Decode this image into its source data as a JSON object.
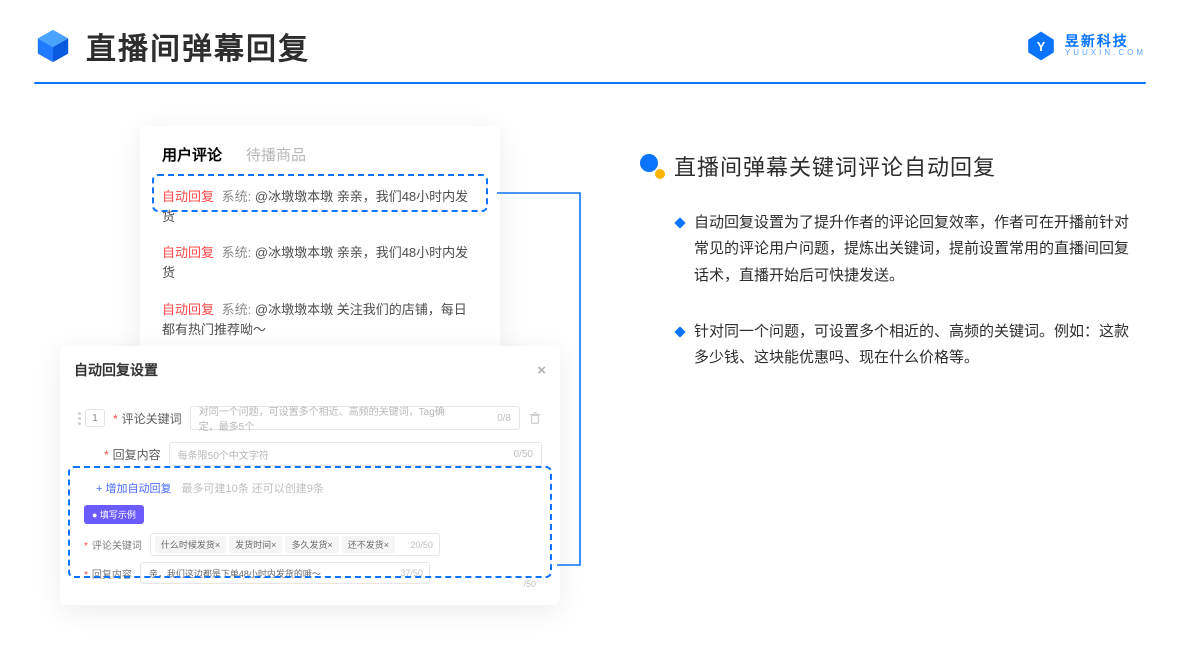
{
  "header": {
    "title": "直播间弹幕回复",
    "brand_name": "昱新科技",
    "brand_sub": "YUUXIN.COM"
  },
  "comment_panel": {
    "tab_active": "用户评论",
    "tab_inactive": "待播商品",
    "rows": [
      {
        "tag": "自动回复",
        "sys": "系统:",
        "text": "@冰墩墩本墩 亲亲，我们48小时内发货"
      },
      {
        "tag": "自动回复",
        "sys": "系统:",
        "text": "@冰墩墩本墩 亲亲，我们48小时内发货"
      },
      {
        "tag": "自动回复",
        "sys": "系统:",
        "text": "@冰墩墩本墩 关注我们的店铺，每日都有热门推荐呦～"
      }
    ]
  },
  "settings_panel": {
    "title": "自动回复设置",
    "index": "1",
    "keyword_label": "评论关键词",
    "keyword_placeholder": "对同一个问题，可设置多个相近、高频的关键词，Tag确定，最多5个",
    "keyword_counter": "0/8",
    "content_label": "回复内容",
    "content_placeholder": "每条限50个中文字符",
    "content_counter": "0/50",
    "add_link": "+ 增加自动回复",
    "add_hint": "最多可建10条 还可以创建9条",
    "example_badge": "● 填写示例",
    "ex_keyword_label": "评论关键词",
    "ex_keywords": [
      "什么时候发货×",
      "发货时间×",
      "多久发货×",
      "还不发货×"
    ],
    "ex_keyword_counter": "20/50",
    "ex_content_label": "回复内容",
    "ex_content_value": "亲，我们这边都是下单48小时内发货的哦～",
    "ex_content_counter": "37/50",
    "extra_counter": "/50"
  },
  "right": {
    "section_title": "直播间弹幕关键词评论自动回复",
    "bullets": [
      "自动回复设置为了提升作者的评论回复效率，作者可在开播前针对常见的评论用户问题，提炼出关键词，提前设置常用的直播间回复话术，直播开始后可快捷发送。",
      "针对同一个问题，可设置多个相近的、高频的关键词。例如：这款多少钱、这块能优惠吗、现在什么价格等。"
    ]
  }
}
